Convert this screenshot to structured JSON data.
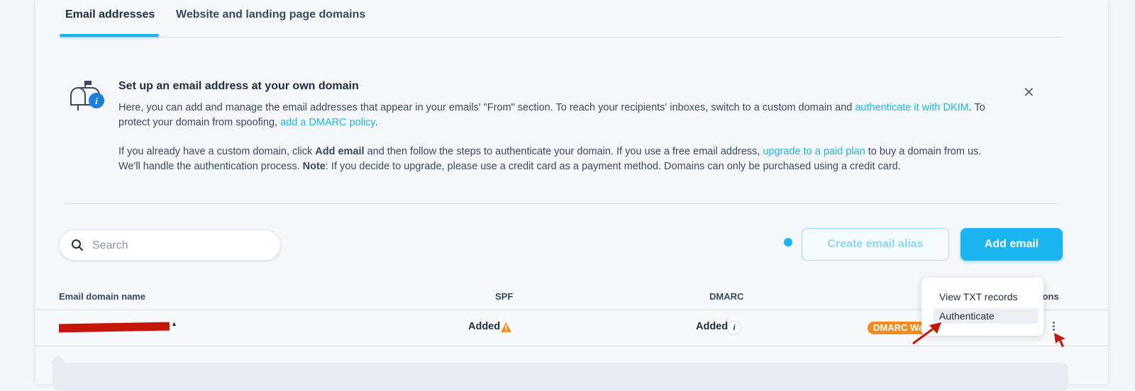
{
  "tabs": [
    {
      "label": "Email addresses"
    },
    {
      "label": "Website and landing page domains"
    }
  ],
  "banner": {
    "title": "Set up an email address at your own domain",
    "p1_a": "Here, you can add and manage the email addresses that appear in your emails' \"From\" section. To reach your recipients' inboxes, switch to a custom domain and ",
    "p1_link1": "authenticate it with DKIM",
    "p1_b": ". To protect your domain from spoofing, ",
    "p1_link2": "add a DMARC policy",
    "p1_c": ".",
    "p2_a": "If you already have a custom domain, click ",
    "p2_bold1": "Add email",
    "p2_b": " and then follow the steps to authenticate your domain. If you use a free email address, ",
    "p2_link": "upgrade to a paid plan",
    "p2_c": " to buy a domain from us. We'll handle the authentication process. ",
    "p2_bold2": "Note",
    "p2_d": ": If you decide to upgrade, please use a credit card as a payment method. Domains can only be purchased using a credit card."
  },
  "search": {
    "placeholder": "Search"
  },
  "buttons": {
    "create_alias": "Create email alias",
    "add_email": "Add email"
  },
  "table": {
    "headers": {
      "domain": "Email domain name",
      "spf": "SPF",
      "dmarc": "DMARC",
      "actions": "ions"
    },
    "rows": [
      {
        "spf": "Added",
        "dmarc": "Added",
        "badge": "DMARC Wa"
      }
    ]
  },
  "menu": {
    "items": [
      "View TXT records",
      "Authenticate"
    ]
  },
  "colors": {
    "accent": "#1ab4f0",
    "warning": "#f28d1d",
    "annotation": "#c2170a"
  }
}
